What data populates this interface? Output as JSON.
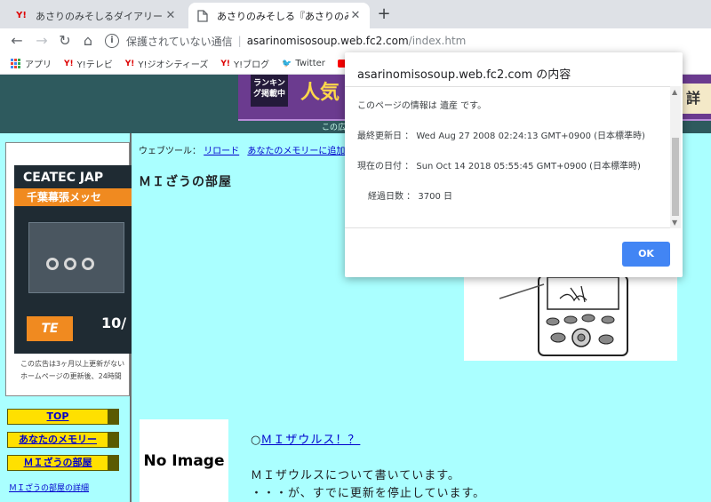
{
  "tabs": [
    {
      "favicon": "Y!",
      "title": "あさりのみそしるダイアリー - Yahoo!ブ"
    },
    {
      "favicon": "page-icon",
      "title": "あさりのみそしる『あさりのみそしる「M"
    }
  ],
  "omnibox": {
    "security_text": "保護されていない通信",
    "host": "asarinomisosoup.web.fc2.com",
    "path": "/index.htm"
  },
  "bookmarks": [
    {
      "icon": "apps-grid-icon",
      "label": "アプリ"
    },
    {
      "icon": "Y!",
      "label": "Y!テレビ"
    },
    {
      "icon": "Y!",
      "label": "Y!ジオシティーズ"
    },
    {
      "icon": "Y!",
      "label": "Y!ブログ"
    },
    {
      "icon": "twitter-icon",
      "label": "Twitter"
    },
    {
      "icon": "youtube-icon",
      "label": "Yo"
    }
  ],
  "banner": {
    "ranking_label": "ランキング掲載中",
    "popular": "人気",
    "detail": "詳",
    "ad_note": "この広告",
    "ad_note2": "す。"
  },
  "left_ad": {
    "headline": "CEATEC JAP",
    "venue": "千葉幕張メッセ",
    "logo": "TE",
    "date": "10/",
    "text_line1": "この広告は3ヶ月以上更新がない",
    "text_line2": "ホームページの更新後、24時間"
  },
  "nav": {
    "top": "TOP",
    "memory": "あなたのメモリー",
    "room": "ＭＩざうの部屋",
    "detail_link": "ＭＩざうの部屋の詳細"
  },
  "webtools": {
    "label": "ウェブツール：",
    "reload": "リロード",
    "add_memory": "あなたのメモリーに追加",
    "more": "ア"
  },
  "content": {
    "heading": "ＭＩざうの部屋",
    "no_image": "No Image",
    "link_prefix": "○",
    "link_text": "ＭＩザウルス！？",
    "desc1": "ＭＩザウルスについて書いています。",
    "desc2": "・・・が、すでに更新を停止しています。"
  },
  "dialog": {
    "title": "asarinomisosoup.web.fc2.com の内容",
    "line1": "このページの情報は 遺産 です。",
    "line2": "最終更新日 ： Wed Aug 27 2008 02:24:13 GMT+0900 (日本標準時)",
    "line3": "現在の日付 ： Sun Oct 14 2018 05:55:45 GMT+0900 (日本標準時)",
    "line4": "経過日数 ： 3700 日",
    "ok_label": "OK"
  }
}
